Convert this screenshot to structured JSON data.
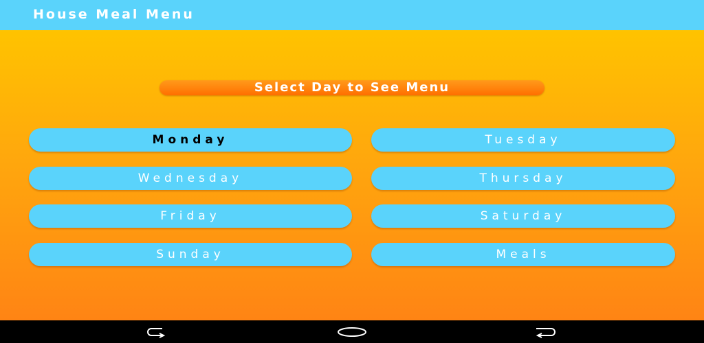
{
  "app": {
    "title": "House Meal Menu"
  },
  "header": {
    "label": "Select Day to See Menu"
  },
  "days": [
    {
      "label": "Monday",
      "selected": true
    },
    {
      "label": "Tuesday",
      "selected": false
    },
    {
      "label": "Wednesday",
      "selected": false
    },
    {
      "label": "Thursday",
      "selected": false
    },
    {
      "label": "Friday",
      "selected": false
    },
    {
      "label": "Saturday",
      "selected": false
    },
    {
      "label": "Sunday",
      "selected": false
    },
    {
      "label": "Meals",
      "selected": false
    }
  ],
  "navigation": {
    "back_icon": "back-icon",
    "home_icon": "home-icon",
    "recents_icon": "recents-icon"
  },
  "colors": {
    "appbar": "#5ad3fb",
    "button": "#5ad3fb",
    "header_pill": "#ff7f00",
    "background_top": "#ffc300",
    "background_bottom": "#ff8414"
  }
}
